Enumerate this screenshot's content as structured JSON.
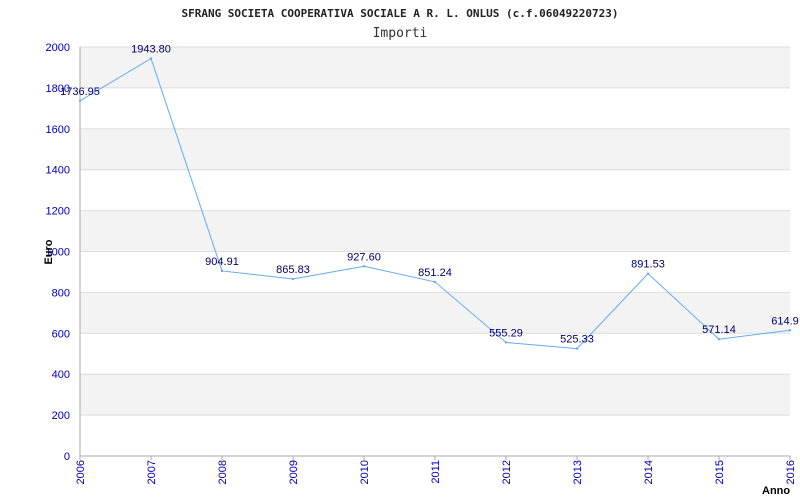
{
  "chart_data": {
    "type": "line",
    "title": "SFRANG SOCIETA COOPERATIVA SOCIALE A R. L. ONLUS (c.f.06049220723)",
    "subtitle": "Importi",
    "xlabel": "Anno",
    "ylabel": "Euro",
    "ylim": [
      0,
      2000
    ],
    "yticks": [
      "0",
      "200",
      "400",
      "600",
      "800",
      "1000",
      "1200",
      "1400",
      "1600",
      "1800",
      "2000"
    ],
    "categories": [
      "2006",
      "2007",
      "2008",
      "2009",
      "2010",
      "2011",
      "2012",
      "2013",
      "2014",
      "2015",
      "2016"
    ],
    "values": [
      1736.95,
      1943.8,
      904.91,
      865.83,
      927.6,
      851.24,
      555.29,
      525.33,
      891.53,
      571.14,
      614.9
    ],
    "value_labels": [
      "1736.95",
      "1943.80",
      "904.91",
      "865.83",
      "927.60",
      "851.24",
      "555.29",
      "525.33",
      "891.53",
      "571.14",
      "614.9"
    ],
    "grid": true,
    "band_color": "#f3f3f3",
    "line_color": "#66aaee",
    "axis_color": "#aaaaaa"
  }
}
